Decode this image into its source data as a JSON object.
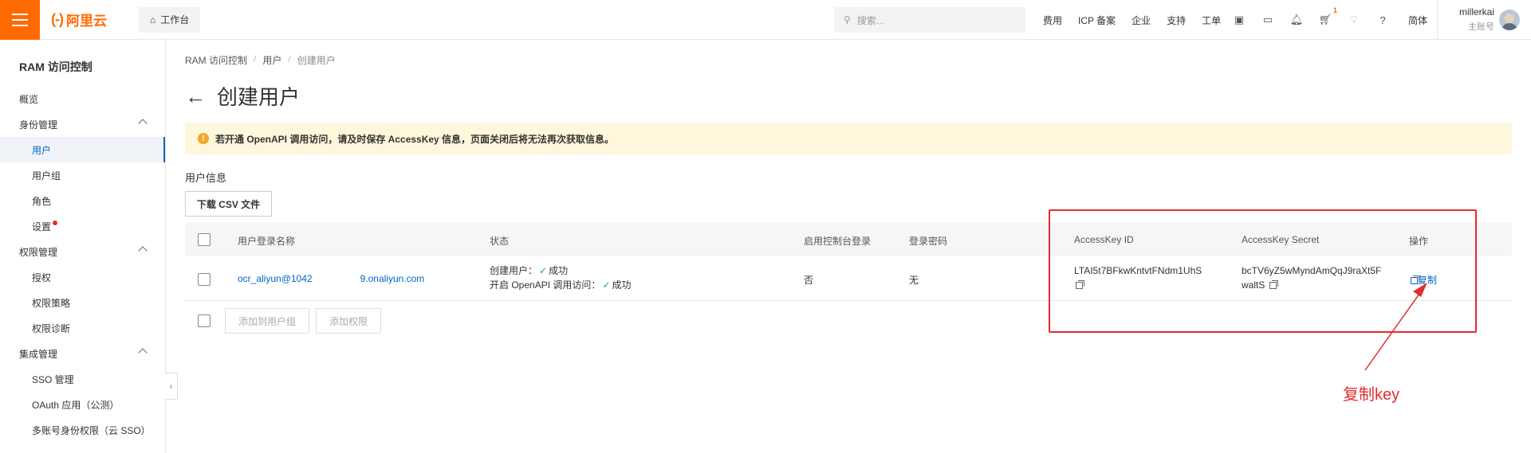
{
  "topbar": {
    "logo_text": "阿里云",
    "workbench": "工作台",
    "search_placeholder": "搜索...",
    "links": [
      "费用",
      "ICP 备案",
      "企业",
      "支持",
      "工单"
    ],
    "cart_badge": "1",
    "lang": "简体",
    "user_name": "millerkai",
    "user_role": "主账号"
  },
  "sidebar": {
    "title": "RAM 访问控制",
    "overview": "概览",
    "identity_group": "身份管理",
    "users": "用户",
    "user_groups": "用户组",
    "roles": "角色",
    "settings": "设置",
    "permission_group": "权限管理",
    "grant": "授权",
    "policies": "权限策略",
    "diagnosis": "权限诊断",
    "integration_group": "集成管理",
    "sso": "SSO 管理",
    "oauth": "OAuth 应用（公测）",
    "multi_sso": "多账号身份权限（云 SSO）"
  },
  "breadcrumb": {
    "root": "RAM 访问控制",
    "mid": "用户",
    "current": "创建用户"
  },
  "page": {
    "title": "创建用户",
    "alert": "若开通 OpenAPI 调用访问，请及时保存 AccessKey 信息，页面关闭后将无法再次获取信息。",
    "section_label": "用户信息",
    "download_btn": "下载 CSV 文件",
    "add_to_group_btn": "添加到用户组",
    "add_permission_btn": "添加权限"
  },
  "table": {
    "headers": {
      "login_name": "用户登录名称",
      "status": "状态",
      "console_login": "启用控制台登录",
      "password": "登录密码",
      "ak_id": "AccessKey ID",
      "ak_secret": "AccessKey Secret",
      "ops": "操作"
    },
    "row": {
      "login_name": "ocr_aliyun@1042                  9.onaliyun.com",
      "status_create_label": "创建用户：",
      "status_create_value": "成功",
      "status_api_label": "开启 OpenAPI 调用访问：",
      "status_api_value": "成功",
      "console_login": "否",
      "password": "无",
      "ak_id": "LTAI5t7BFkwKntvtFNdm1UhS",
      "ak_secret_line1": "bcTV6yZ5wMyndAmQqJ9raXt5F",
      "ak_secret_line2": "waltS",
      "copy": "复制"
    }
  },
  "annotation": {
    "text": "复制key",
    "color": "#e02d2d"
  },
  "colors": {
    "brand": "#ff6a00",
    "link": "#0064c8",
    "alert_bg": "#fff7db"
  }
}
